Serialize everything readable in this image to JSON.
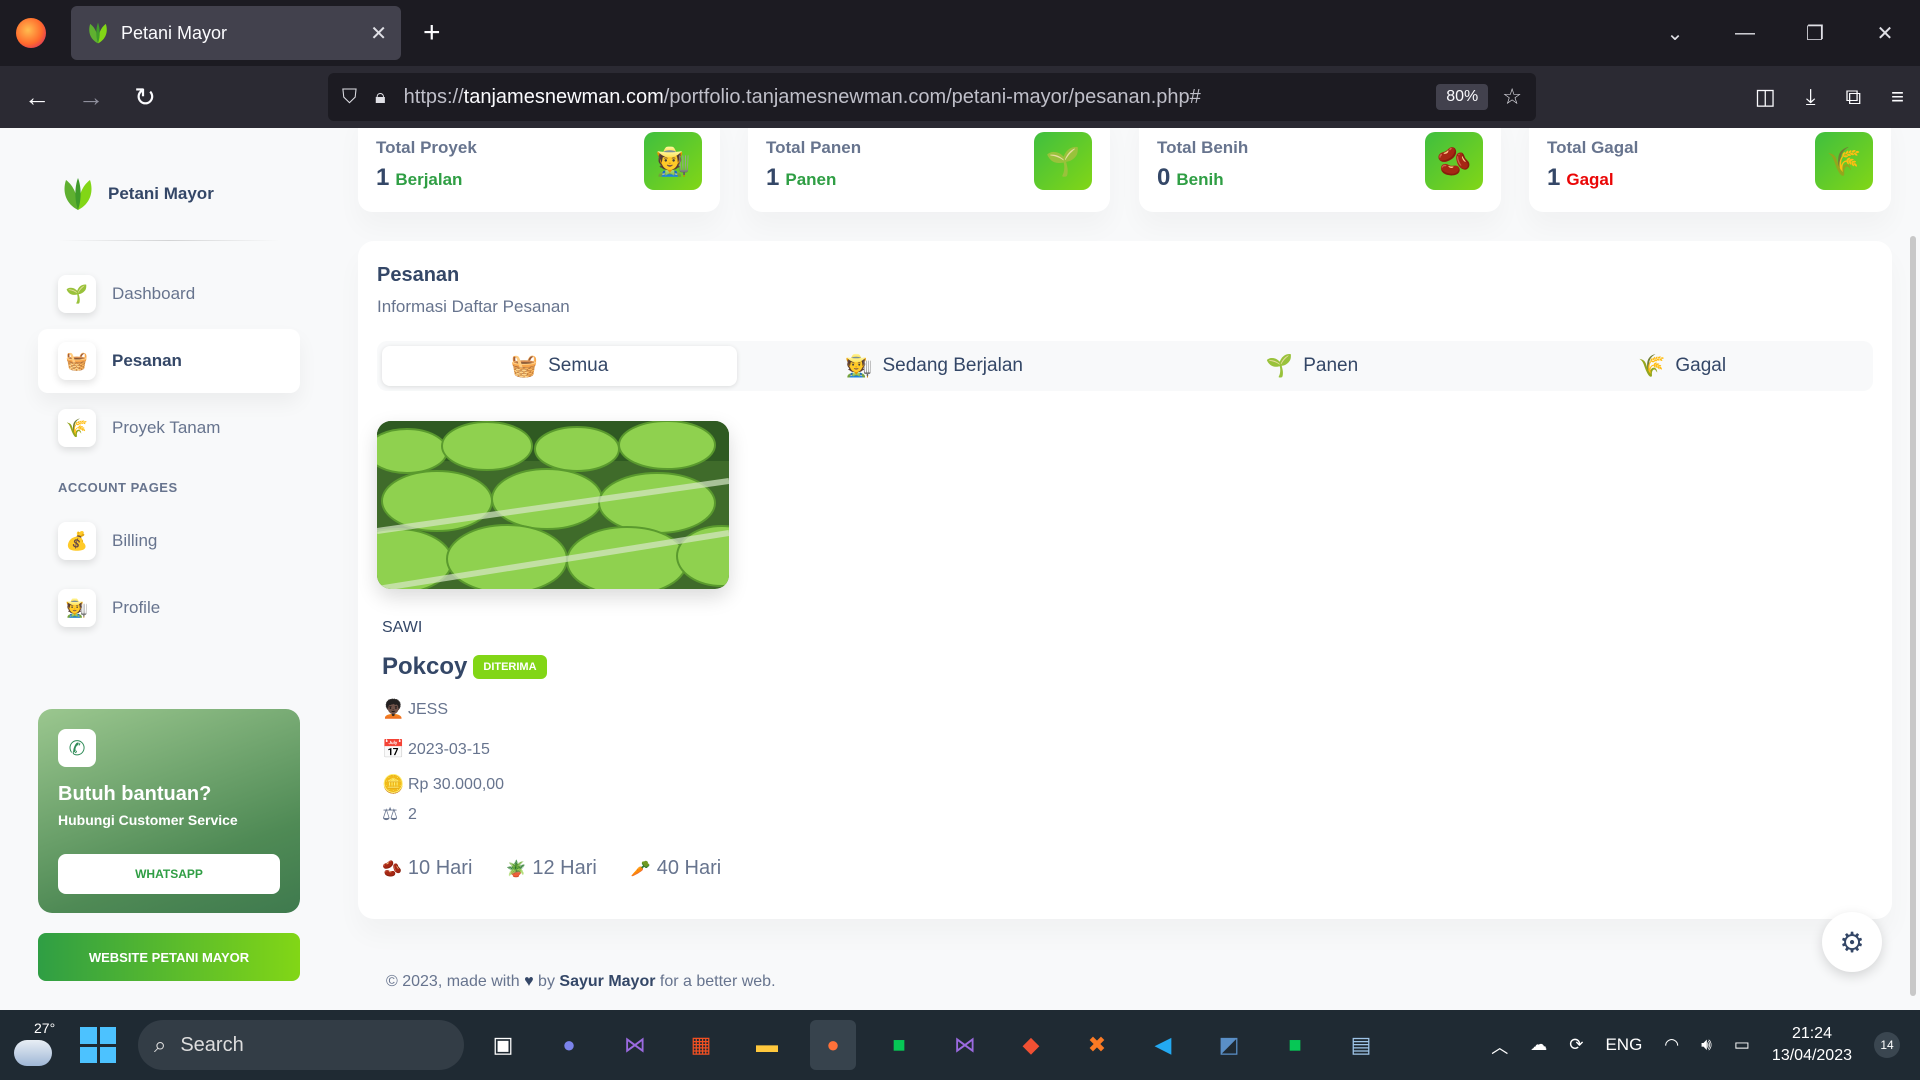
{
  "browser": {
    "tab_title": "Petani Mayor",
    "url_prefix": "https://",
    "url_domain": "tanjamesnewman.com",
    "url_path": "/portfolio.tanjamesnewman.com/petani-mayor/pesanan.php#",
    "zoom": "80%"
  },
  "sidebar": {
    "brand": "Petani Mayor",
    "items": [
      {
        "label": "Dashboard",
        "icon": "🌱"
      },
      {
        "label": "Pesanan",
        "icon": "🧺"
      },
      {
        "label": "Proyek Tanam",
        "icon": "🌾"
      }
    ],
    "section_title": "ACCOUNT PAGES",
    "account_items": [
      {
        "label": "Billing",
        "icon": "💰"
      },
      {
        "label": "Profile",
        "icon": "🧑‍🌾"
      }
    ],
    "help_title": "Butuh bantuan?",
    "help_sub": "Hubungi Customer Service",
    "help_button": "WHATSAPP",
    "website_button": "WEBSITE PETANI MAYOR"
  },
  "stats": [
    {
      "label": "Total Proyek",
      "value": "1",
      "unit": "Berjalan",
      "unit_color": "#2f9e44",
      "icon": "🧑‍🌾"
    },
    {
      "label": "Total Panen",
      "value": "1",
      "unit": "Panen",
      "unit_color": "#2f9e44",
      "icon": "🌱"
    },
    {
      "label": "Total Benih",
      "value": "0",
      "unit": "Benih",
      "unit_color": "#2f9e44",
      "icon": "🫘"
    },
    {
      "label": "Total Gagal",
      "value": "1",
      "unit": "Gagal",
      "unit_color": "#ea0606",
      "icon": "🌾"
    }
  ],
  "orders": {
    "title": "Pesanan",
    "subtitle": "Informasi Daftar Pesanan",
    "tabs": [
      {
        "label": "Semua",
        "icon": "🧺"
      },
      {
        "label": "Sedang Berjalan",
        "icon": "🧑‍🌾"
      },
      {
        "label": "Panen",
        "icon": "🌱"
      },
      {
        "label": "Gagal",
        "icon": "🌾"
      }
    ],
    "item": {
      "category": "SAWI",
      "name": "Pokcoy",
      "status": "DITERIMA",
      "farmer": "JESS",
      "date": "2023-03-15",
      "price": "Rp 30.000,00",
      "quantity": "2",
      "durations": [
        "10 Hari",
        "12 Hari",
        "40 Hari"
      ]
    }
  },
  "footer": {
    "pre": "© 2023, made with",
    "by": "by",
    "brand": "Sayur Mayor",
    "post": "for a better web."
  },
  "taskbar": {
    "temperature": "27°",
    "search_placeholder": "Search",
    "lang": "ENG",
    "time": "21:24",
    "date": "13/04/2023",
    "notifications": "14"
  }
}
